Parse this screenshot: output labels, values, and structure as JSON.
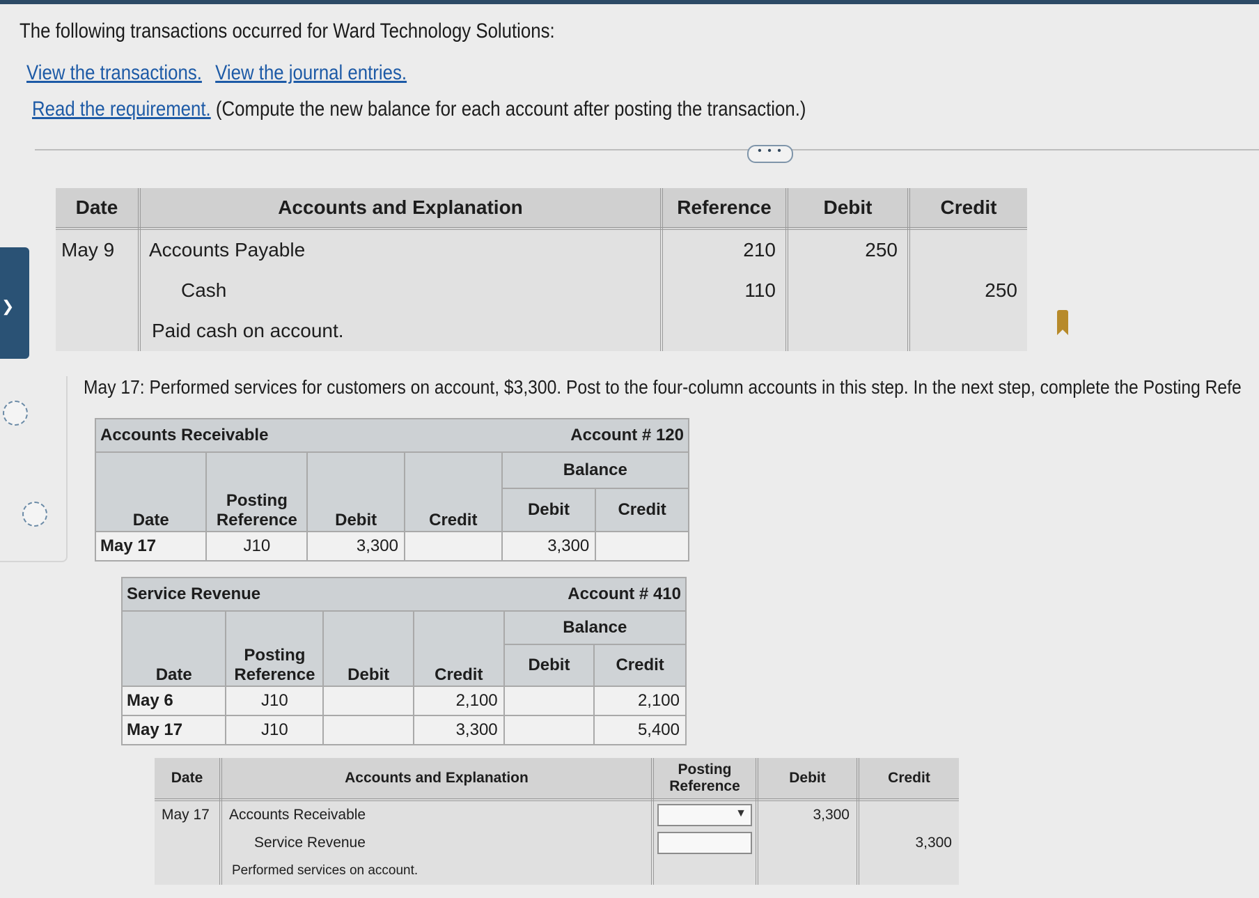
{
  "header": {
    "intro": "The following transactions occurred for Ward Technology Solutions:",
    "link_transactions": "View the transactions.",
    "link_journal": "View the journal entries.",
    "link_requirement": "Read the requirement.",
    "requirement_note": "(Compute the new balance for each account after posting the transaction.)",
    "more_label": "• • •"
  },
  "journal_top": {
    "headers": [
      "Date",
      "Accounts and Explanation",
      "Reference",
      "Debit",
      "Credit"
    ],
    "date": "May 9",
    "debit_account": "Accounts Payable",
    "credit_account": "Cash",
    "explanation": "Paid cash on account.",
    "debit_ref": "210",
    "credit_ref": "110",
    "debit_amount": "250",
    "credit_amount": "250"
  },
  "step_text": "May 17: Performed services for customers on account, $3,300. Post to the four-column accounts in this step. In the next step, complete the Posting Refe",
  "ledger_ar": {
    "name": "Accounts Receivable",
    "account_no": "Account # 120",
    "balance": "Balance",
    "col_date": "Date",
    "col_post": "Posting Reference",
    "col_debit": "Debit",
    "col_credit": "Credit",
    "col_bal_debit": "Debit",
    "col_bal_credit": "Credit",
    "rows": [
      {
        "date": "May 17",
        "ref": "J10",
        "debit": "3,300",
        "credit": "",
        "bal_debit": "3,300",
        "bal_credit": ""
      }
    ]
  },
  "ledger_sr": {
    "name": "Service Revenue",
    "account_no": "Account # 410",
    "balance": "Balance",
    "col_date": "Date",
    "col_post": "Posting Reference",
    "col_debit": "Debit",
    "col_credit": "Credit",
    "col_bal_debit": "Debit",
    "col_bal_credit": "Credit",
    "rows": [
      {
        "date": "May 6",
        "ref": "J10",
        "debit": "",
        "credit": "2,100",
        "bal_debit": "",
        "bal_credit": "2,100"
      },
      {
        "date": "May 17",
        "ref": "J10",
        "debit": "",
        "credit": "3,300",
        "bal_debit": "",
        "bal_credit": "5,400"
      }
    ]
  },
  "journal_bottom": {
    "headers": [
      "Date",
      "Accounts and Explanation",
      "Posting Reference",
      "Debit",
      "Credit"
    ],
    "date": "May 17",
    "debit_account": "Accounts Receivable",
    "credit_account": "Service Revenue",
    "explanation": "Performed services on account.",
    "debit_amount": "3,300",
    "credit_amount": "3,300"
  }
}
